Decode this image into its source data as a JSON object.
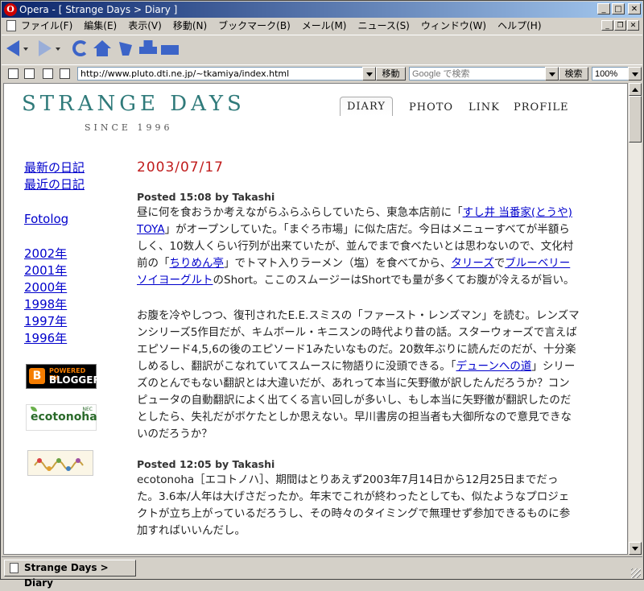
{
  "window": {
    "title": "Opera - [ Strange Days > Diary ]"
  },
  "menu": {
    "items": [
      "ファイル(F)",
      "編集(E)",
      "表示(V)",
      "移動(N)",
      "ブックマーク(B)",
      "メール(M)",
      "ニュース(S)",
      "ウィンドウ(W)",
      "ヘルプ(H)"
    ]
  },
  "address": {
    "url": "http://www.pluto.dti.ne.jp/~tkamiya/index.html",
    "go_label": "移動",
    "search_placeholder": "Google で検索",
    "search_button": "検索",
    "zoom": "100%"
  },
  "site": {
    "logo": "STRANGE DAYS",
    "logo_sub": "SINCE 1996",
    "nav": [
      "DIARY",
      "PHOTO",
      "LINK",
      "PROFILE"
    ],
    "active_nav": "DIARY"
  },
  "sidebar": {
    "links_a": [
      "最新の日記",
      "最近の日記"
    ],
    "fotolog": "Fotolog",
    "years": [
      "2002年",
      "2001年",
      "2000年",
      "1998年",
      "1997年",
      "1996年"
    ],
    "badges": {
      "blogger_top": "POWERED BY",
      "blogger_main": "BLOGGER",
      "eco_main": "ecotonoha",
      "eco_sub": "NEC"
    }
  },
  "post": {
    "date": "2003/07/17",
    "entries": [
      {
        "posted": "Posted 15:08 by Takashi",
        "p1": {
          "t1": "昼に何を食おうか考えながらふらふらしていたら、東急本店前に「",
          "l1": "すし井 当番家(とうや) TOYA",
          "t2": "」がオープンしていた。「まぐろ市場」に似た店だ。今日はメニューすべてが半額らしく、10数人くらい行列が出来ていたが、並んでまで食べたいとは思わないので、文化村前の「",
          "l2": "ちりめん亭",
          "t3": "」でトマト入りラーメン（塩）を食べてから、",
          "l3": "タリーズ",
          "t4": "で",
          "l4": "ブルーベリーソイヨーグルト",
          "t5": "のShort。ここのスムージーはShortでも量が多くてお腹が冷えるが旨い。"
        },
        "p2": {
          "t1": "お腹を冷やしつつ、復刊されたE.E.スミスの「ファースト・レンズマン」を読む。レンズマンシリーズ5作目だが、キムボール・キニスンの時代より昔の話。スターウォーズで言えばエピソード4,5,6の後のエピソード1みたいなものだ。20数年ぶりに読んだのだが、十分楽しめるし、翻訳がこなれていてスムースに物語りに没頭できる。「",
          "l1": "デューンへの道",
          "t2": "」シリーズのとんでもない翻訳とは大違いだが、あれって本当に矢野徹が訳したんだろうか？コンピュータの自動翻訳によく出てくる言い回しが多いし、もし本当に矢野徹が翻訳したのだとしたら、失礼だがボケたとしか思えない。早川書房の担当者も大御所なので意見できないのだろうか？"
        }
      },
      {
        "posted": "Posted 12:05 by Takashi",
        "p1": {
          "t1": "ecotonoha［エコトノハ］、期間はとりあえず2003年7月14日から12月25日までだった。3.6本/人年は大げさだったか。年末でこれが終わったとしても、似たようなプロジェクトが立ち上がっているだろうし、その時々のタイミングで無理せず参加できるものに参加すればいいんだし。"
        }
      }
    ]
  },
  "status": {
    "tab_label": "Strange Days > Diary"
  },
  "colors": {
    "accent_link": "#0000cc",
    "date_red": "#c01c1c",
    "logo_teal": "#2f7a7a",
    "title_bar": "#0a246a"
  }
}
